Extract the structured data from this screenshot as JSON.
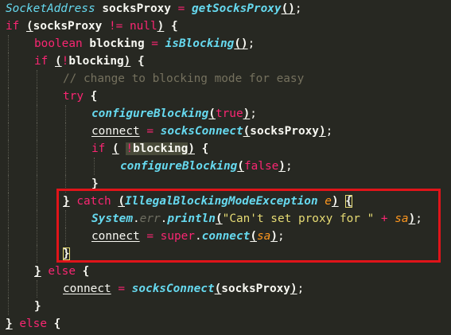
{
  "editor": {
    "lines": [
      {
        "indent": 0,
        "tokens": [
          {
            "t": "SocketAddress",
            "c": "ty"
          },
          {
            "t": " ",
            "c": "pl"
          },
          {
            "t": "socksProxy",
            "c": "id"
          },
          {
            "t": " = ",
            "c": "kw"
          },
          {
            "t": "getSocksProxy",
            "c": "fn"
          },
          {
            "t": "()",
            "c": "id u"
          },
          {
            "t": ";",
            "c": "pl"
          }
        ]
      },
      {
        "indent": 0,
        "tokens": [
          {
            "t": "if",
            "c": "kw"
          },
          {
            "t": " ",
            "c": "pl"
          },
          {
            "t": "(",
            "c": "id u"
          },
          {
            "t": "socksProxy",
            "c": "id"
          },
          {
            "t": " != ",
            "c": "kw"
          },
          {
            "t": "null",
            "c": "kw"
          },
          {
            "t": ")",
            "c": "id u"
          },
          {
            "t": " {",
            "c": "id"
          }
        ]
      },
      {
        "indent": 1,
        "tokens": [
          {
            "t": "boolean",
            "c": "kw"
          },
          {
            "t": " ",
            "c": "pl"
          },
          {
            "t": "blocking",
            "c": "id"
          },
          {
            "t": " = ",
            "c": "kw"
          },
          {
            "t": "isBlocking",
            "c": "fn"
          },
          {
            "t": "()",
            "c": "id u"
          },
          {
            "t": ";",
            "c": "pl"
          }
        ]
      },
      {
        "indent": 1,
        "tokens": [
          {
            "t": "if",
            "c": "kw"
          },
          {
            "t": " ",
            "c": "pl"
          },
          {
            "t": "(",
            "c": "id u"
          },
          {
            "t": "!",
            "c": "kw"
          },
          {
            "t": "blocking",
            "c": "id"
          },
          {
            "t": ")",
            "c": "id u"
          },
          {
            "t": " {",
            "c": "id"
          }
        ]
      },
      {
        "indent": 2,
        "tokens": [
          {
            "t": "// change to blocking mode for easy",
            "c": "cm"
          }
        ]
      },
      {
        "indent": 2,
        "tokens": [
          {
            "t": "try",
            "c": "kw"
          },
          {
            "t": " {",
            "c": "id"
          }
        ]
      },
      {
        "indent": 3,
        "tokens": [
          {
            "t": "configureBlocking",
            "c": "fn"
          },
          {
            "t": "(",
            "c": "id u"
          },
          {
            "t": "true",
            "c": "kw"
          },
          {
            "t": ")",
            "c": "id u"
          },
          {
            "t": ";",
            "c": "pl"
          }
        ]
      },
      {
        "indent": 3,
        "tokens": [
          {
            "t": "connect",
            "c": "pl u"
          },
          {
            "t": " = ",
            "c": "kw"
          },
          {
            "t": "socksConnect",
            "c": "fn"
          },
          {
            "t": "(",
            "c": "id u"
          },
          {
            "t": "socksProxy",
            "c": "id"
          },
          {
            "t": ")",
            "c": "id u"
          },
          {
            "t": ";",
            "c": "pl"
          }
        ]
      },
      {
        "indent": 3,
        "tokens": [
          {
            "t": "if",
            "c": "kw"
          },
          {
            "t": " ",
            "c": "pl"
          },
          {
            "t": "(",
            "c": "id u"
          },
          {
            "t": " ",
            "c": "pl"
          },
          {
            "t": "!",
            "c": "kw warn"
          },
          {
            "t": "blocking",
            "c": "id warn"
          },
          {
            "t": ")",
            "c": "id u"
          },
          {
            "t": " {",
            "c": "id"
          }
        ]
      },
      {
        "indent": 4,
        "tokens": [
          {
            "t": "configureBlocking",
            "c": "fn"
          },
          {
            "t": "(",
            "c": "id u"
          },
          {
            "t": "false",
            "c": "kw"
          },
          {
            "t": ")",
            "c": "id u"
          },
          {
            "t": ";",
            "c": "pl"
          }
        ]
      },
      {
        "indent": 3,
        "tokens": [
          {
            "t": "}",
            "c": "id"
          }
        ]
      },
      {
        "indent": 2,
        "tokens": [
          {
            "t": "}",
            "c": "id u"
          },
          {
            "t": " ",
            "c": "pl"
          },
          {
            "t": "catch",
            "c": "kw"
          },
          {
            "t": " ",
            "c": "pl"
          },
          {
            "t": "(",
            "c": "id u"
          },
          {
            "t": "IllegalBlockingModeException",
            "c": "fn"
          },
          {
            "t": " ",
            "c": "pl"
          },
          {
            "t": "e",
            "c": "pr"
          },
          {
            "t": ")",
            "c": "id u"
          },
          {
            "t": " ",
            "c": "pl"
          },
          {
            "t": "{",
            "c": "id brk"
          }
        ]
      },
      {
        "indent": 3,
        "tokens": [
          {
            "t": "System",
            "c": "fn"
          },
          {
            "t": ".",
            "c": "pl"
          },
          {
            "t": "err",
            "c": "fld"
          },
          {
            "t": ".",
            "c": "pl"
          },
          {
            "t": "println",
            "c": "fn"
          },
          {
            "t": "(",
            "c": "id u"
          },
          {
            "t": "\"Can't set proxy for \"",
            "c": "st"
          },
          {
            "t": " + ",
            "c": "kw"
          },
          {
            "t": "sa",
            "c": "pr"
          },
          {
            "t": ")",
            "c": "id u"
          },
          {
            "t": ";",
            "c": "pl"
          }
        ]
      },
      {
        "indent": 3,
        "tokens": [
          {
            "t": "connect",
            "c": "pl u"
          },
          {
            "t": " = ",
            "c": "kw"
          },
          {
            "t": "super",
            "c": "kw"
          },
          {
            "t": ".",
            "c": "pl"
          },
          {
            "t": "connect",
            "c": "fn"
          },
          {
            "t": "(",
            "c": "id u"
          },
          {
            "t": "sa",
            "c": "pr"
          },
          {
            "t": ")",
            "c": "id u"
          },
          {
            "t": ";",
            "c": "pl"
          }
        ]
      },
      {
        "indent": 2,
        "tokens": [
          {
            "t": "}",
            "c": "id brk"
          }
        ]
      },
      {
        "indent": 1,
        "tokens": [
          {
            "t": "}",
            "c": "id u"
          },
          {
            "t": " ",
            "c": "pl"
          },
          {
            "t": "else",
            "c": "kw"
          },
          {
            "t": " {",
            "c": "id"
          }
        ]
      },
      {
        "indent": 2,
        "tokens": [
          {
            "t": "connect",
            "c": "pl u"
          },
          {
            "t": " = ",
            "c": "kw"
          },
          {
            "t": "socksConnect",
            "c": "fn"
          },
          {
            "t": "(",
            "c": "id u"
          },
          {
            "t": "socksProxy",
            "c": "id"
          },
          {
            "t": ")",
            "c": "id u"
          },
          {
            "t": ";",
            "c": "pl"
          }
        ]
      },
      {
        "indent": 1,
        "tokens": [
          {
            "t": "}",
            "c": "id"
          }
        ]
      },
      {
        "indent": 0,
        "tokens": [
          {
            "t": "}",
            "c": "id u"
          },
          {
            "t": " ",
            "c": "pl"
          },
          {
            "t": "else",
            "c": "kw"
          },
          {
            "t": " {",
            "c": "id"
          }
        ]
      }
    ]
  },
  "colors": {
    "background": "#272822",
    "keyword": "#f92672",
    "type": "#66d9ef",
    "string": "#e6db74",
    "comment": "#75715e",
    "parameter": "#fd971f",
    "highlight_box": "#e0141a"
  }
}
